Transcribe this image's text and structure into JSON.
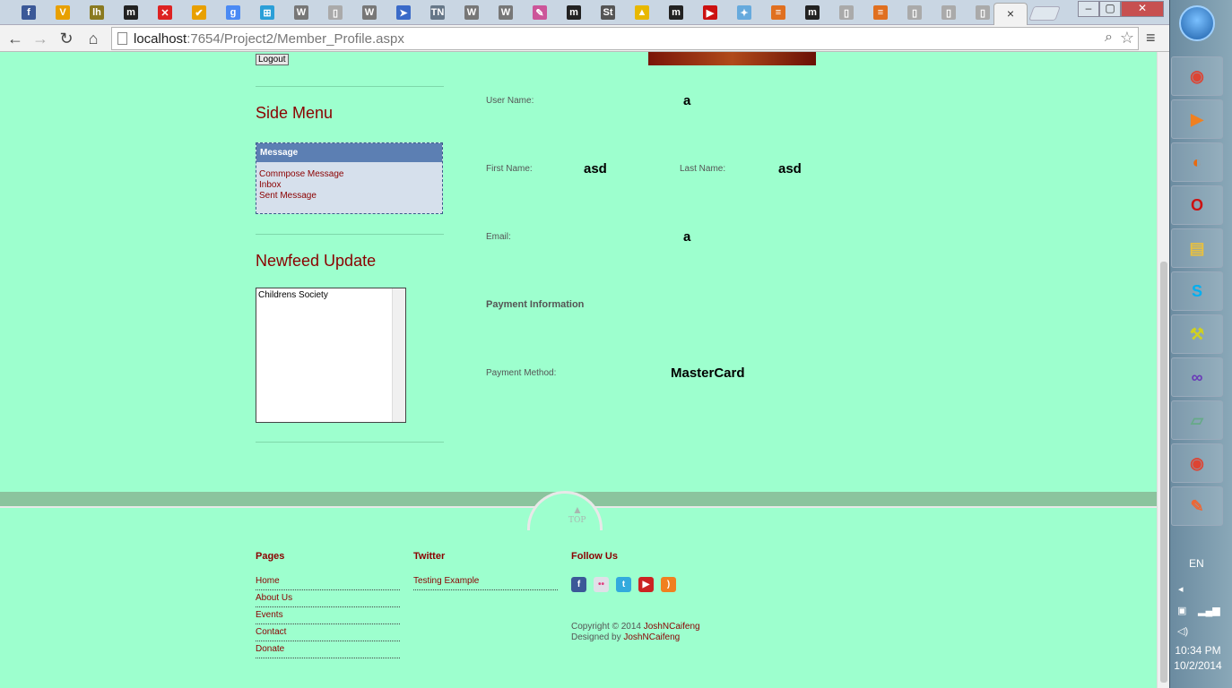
{
  "browser": {
    "tabs": [
      {
        "icon": "facebook-icon",
        "glyph": "f",
        "color": "#3b5998"
      },
      {
        "icon": "v-icon",
        "glyph": "V",
        "color": "#e8a000"
      },
      {
        "icon": "lh-icon",
        "glyph": "lh",
        "color": "#8a7a20"
      },
      {
        "icon": "medium-icon",
        "glyph": "m",
        "color": "#222222"
      },
      {
        "icon": "close-red-icon",
        "glyph": "✕",
        "color": "#dd2222"
      },
      {
        "icon": "check-icon",
        "glyph": "✔",
        "color": "#e8a000"
      },
      {
        "icon": "google-icon",
        "glyph": "g",
        "color": "#4a8af4"
      },
      {
        "icon": "windows-icon",
        "glyph": "⊞",
        "color": "#2a9fd8"
      },
      {
        "icon": "wikipedia-icon",
        "glyph": "W",
        "color": "#777777"
      },
      {
        "icon": "page-icon",
        "glyph": "▯",
        "color": "#aaaaaa"
      },
      {
        "icon": "wikipedia-icon",
        "glyph": "W",
        "color": "#777777"
      },
      {
        "icon": "bird-icon",
        "glyph": "➤",
        "color": "#3a6ac8"
      },
      {
        "icon": "tn-icon",
        "glyph": "TN",
        "color": "#667788"
      },
      {
        "icon": "wikipedia-icon",
        "glyph": "W",
        "color": "#777777"
      },
      {
        "icon": "wikipedia-icon",
        "glyph": "W",
        "color": "#777777"
      },
      {
        "icon": "puzzle-icon",
        "glyph": "✎",
        "color": "#cc5599"
      },
      {
        "icon": "medium-icon",
        "glyph": "m",
        "color": "#222222"
      },
      {
        "icon": "st-icon",
        "glyph": "St",
        "color": "#555555"
      },
      {
        "icon": "drive-icon",
        "glyph": "▲",
        "color": "#e8b800"
      },
      {
        "icon": "medium-icon",
        "glyph": "m",
        "color": "#222222"
      },
      {
        "icon": "youtube-icon",
        "glyph": "▶",
        "color": "#cc1111"
      },
      {
        "icon": "app-icon",
        "glyph": "✦",
        "color": "#66aadd"
      },
      {
        "icon": "stack-icon",
        "glyph": "≡",
        "color": "#e07020"
      },
      {
        "icon": "medium-icon",
        "glyph": "m",
        "color": "#222222"
      },
      {
        "icon": "page-icon",
        "glyph": "▯",
        "color": "#aaaaaa"
      },
      {
        "icon": "stack-icon",
        "glyph": "≡",
        "color": "#e07020"
      },
      {
        "icon": "page-icon",
        "glyph": "▯",
        "color": "#aaaaaa"
      },
      {
        "icon": "page-icon",
        "glyph": "▯",
        "color": "#aaaaaa"
      },
      {
        "icon": "page-icon",
        "glyph": "▯",
        "color": "#aaaaaa"
      }
    ],
    "active_tab_close": "×",
    "url_host": "localhost",
    "url_rest": ":7654/Project2/Member_Profile.aspx",
    "win_min": "–",
    "win_max": "▢",
    "win_close": "✕"
  },
  "page": {
    "logout_label": "Logout",
    "side_menu_title": "Side Menu",
    "message_header": "Message",
    "message_links": [
      "Commpose Message",
      "Inbox",
      "Sent Message"
    ],
    "newsfeed_title": "Newfeed Update",
    "newsfeed_items": [
      "Childrens Society"
    ],
    "profile": {
      "username_label": "User Name:",
      "username_value": "a",
      "firstname_label": "First Name:",
      "firstname_value": "asd",
      "lastname_label": "Last Name:",
      "lastname_value": "asd",
      "email_label": "Email:",
      "email_value": "a",
      "payment_heading": "Payment Information",
      "payment_method_label": "Payment Method:",
      "payment_method_value": "MasterCard"
    },
    "top_label": "TOP",
    "footer": {
      "pages_heading": "Pages",
      "pages_links": [
        "Home",
        "About Us",
        "Events",
        "Contact",
        "Donate"
      ],
      "twitter_heading": "Twitter",
      "twitter_link": "Testing Example",
      "follow_heading": "Follow Us",
      "social": [
        {
          "icon": "facebook-icon",
          "glyph": "f",
          "color": "#3b5998"
        },
        {
          "icon": "flickr-icon",
          "glyph": "••",
          "color": "#e0e0e8"
        },
        {
          "icon": "twitter-icon",
          "glyph": "t",
          "color": "#33aadd"
        },
        {
          "icon": "youtube-icon",
          "glyph": "▶",
          "color": "#cc2222"
        },
        {
          "icon": "rss-icon",
          "glyph": ")",
          "color": "#f08020"
        }
      ],
      "copyright_prefix": "Copyright © 2014 ",
      "copyright_name": "JoshNCaifeng",
      "designed_prefix": "Designed by ",
      "designed_name": "JoshNCaifeng"
    }
  },
  "taskbar": {
    "apps": [
      {
        "icon": "chrome-icon",
        "glyph": "◉",
        "color": "#dd4433"
      },
      {
        "icon": "media-player-icon",
        "glyph": "▶",
        "color": "#f08020"
      },
      {
        "icon": "firefox-icon",
        "glyph": "◐",
        "color": "#e86a10"
      },
      {
        "icon": "opera-icon",
        "glyph": "O",
        "color": "#cc1111"
      },
      {
        "icon": "explorer-icon",
        "glyph": "▤",
        "color": "#e8c040"
      },
      {
        "icon": "skype-icon",
        "glyph": "S",
        "color": "#00aff0"
      },
      {
        "icon": "tools-icon",
        "glyph": "⚒",
        "color": "#d0d020"
      },
      {
        "icon": "visual-studio-icon",
        "glyph": "∞",
        "color": "#6a3ab8"
      },
      {
        "icon": "notebook-icon",
        "glyph": "▱",
        "color": "#66aa88"
      },
      {
        "icon": "chrome-icon",
        "glyph": "◉",
        "color": "#dd4433"
      },
      {
        "icon": "paint-icon",
        "glyph": "✎",
        "color": "#ee6633"
      }
    ],
    "language": "EN",
    "time": "10:34 PM",
    "date": "10/2/2014"
  }
}
